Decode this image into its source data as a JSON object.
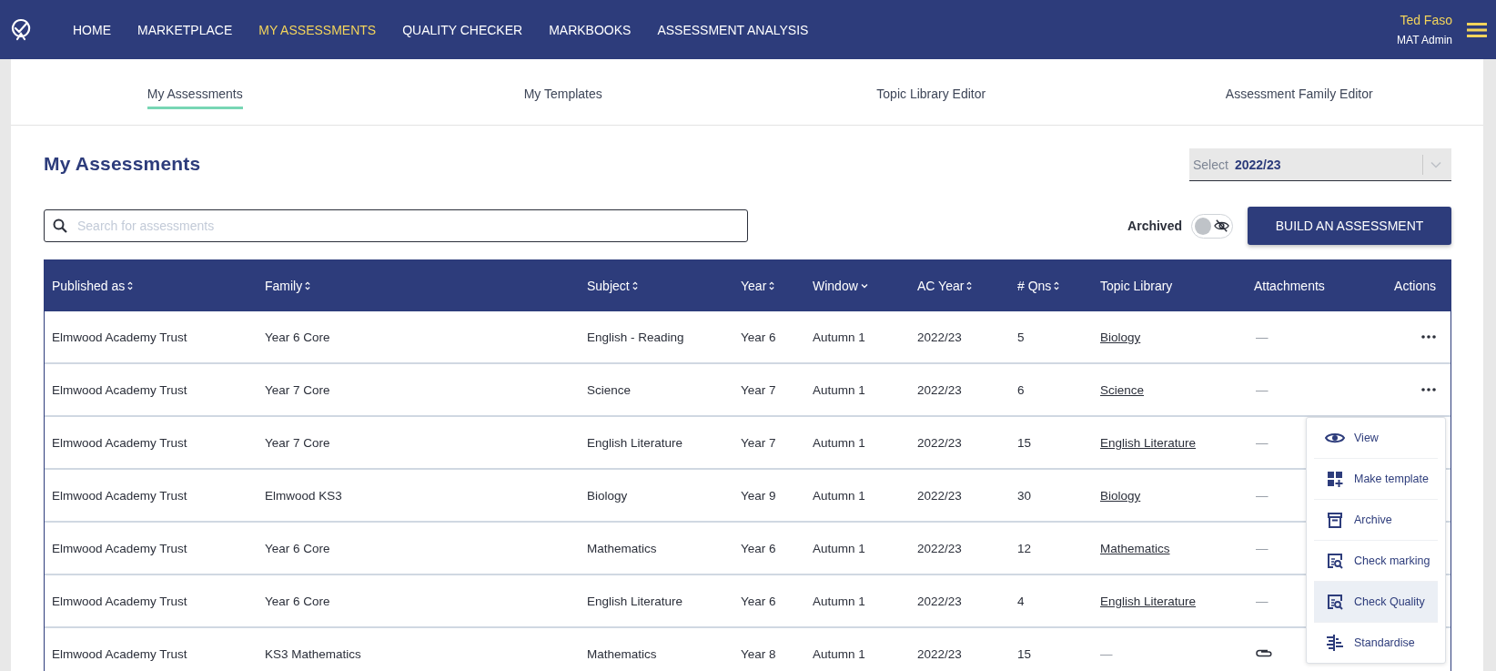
{
  "nav": {
    "items": [
      {
        "label": "HOME",
        "selected": false
      },
      {
        "label": "MARKETPLACE",
        "selected": false
      },
      {
        "label": "MY ASSESSMENTS",
        "selected": true
      },
      {
        "label": "QUALITY CHECKER",
        "selected": false
      },
      {
        "label": "MARKBOOKS",
        "selected": false
      },
      {
        "label": "ASSESSMENT ANALYSIS",
        "selected": false
      }
    ],
    "user": {
      "name": "Ted Faso",
      "role": "MAT Admin"
    }
  },
  "tabs": [
    {
      "label": "My Assessments",
      "selected": true
    },
    {
      "label": "My Templates",
      "selected": false
    },
    {
      "label": "Topic Library Editor",
      "selected": false
    },
    {
      "label": "Assessment Family Editor",
      "selected": false
    }
  ],
  "page_title": "My Assessments",
  "year_select": {
    "label": "Select",
    "value": "2022/23"
  },
  "search": {
    "placeholder": "Search for assessments"
  },
  "archived_toggle": {
    "label": "Archived",
    "on": false
  },
  "build_button": "BUILD AN ASSESSMENT",
  "table": {
    "columns": [
      {
        "label": "Published as",
        "sortable": true,
        "dropdown": false
      },
      {
        "label": "Family",
        "sortable": true,
        "dropdown": false
      },
      {
        "label": "Subject",
        "sortable": true,
        "dropdown": false
      },
      {
        "label": "Year",
        "sortable": true,
        "dropdown": false
      },
      {
        "label": "Window",
        "sortable": false,
        "dropdown": true
      },
      {
        "label": "AC Year",
        "sortable": true,
        "dropdown": false
      },
      {
        "label": "# Qns",
        "sortable": true,
        "dropdown": false
      },
      {
        "label": "Topic Library",
        "sortable": false,
        "dropdown": false
      },
      {
        "label": "Attachments",
        "sortable": false,
        "dropdown": false
      },
      {
        "label": "Actions",
        "sortable": false,
        "dropdown": false
      }
    ],
    "rows": [
      {
        "published_as": "Elmwood Academy Trust",
        "family": "Year 6 Core",
        "subject": "English - Reading",
        "year": "Year 6",
        "window": "Autumn 1",
        "ac_year": "2022/23",
        "qns": "5",
        "topic_library": {
          "kind": "link",
          "text": "Biology"
        },
        "attachments": {
          "kind": "none",
          "text": "—"
        }
      },
      {
        "published_as": "Elmwood Academy Trust",
        "family": "Year 7 Core",
        "subject": "Science",
        "year": "Year 7",
        "window": "Autumn 1",
        "ac_year": "2022/23",
        "qns": "6",
        "topic_library": {
          "kind": "link",
          "text": "Science"
        },
        "attachments": {
          "kind": "none",
          "text": "—"
        }
      },
      {
        "published_as": "Elmwood Academy Trust",
        "family": "Year 7 Core",
        "subject": "English Literature",
        "year": "Year 7",
        "window": "Autumn 1",
        "ac_year": "2022/23",
        "qns": "15",
        "topic_library": {
          "kind": "link",
          "text": "English Literature"
        },
        "attachments": {
          "kind": "none",
          "text": "—"
        }
      },
      {
        "published_as": "Elmwood Academy Trust",
        "family": "Elmwood KS3",
        "subject": "Biology",
        "year": "Year 9",
        "window": "Autumn 1",
        "ac_year": "2022/23",
        "qns": "30",
        "topic_library": {
          "kind": "link",
          "text": "Biology"
        },
        "attachments": {
          "kind": "none",
          "text": "—"
        }
      },
      {
        "published_as": "Elmwood Academy Trust",
        "family": "Year 6 Core",
        "subject": "Mathematics",
        "year": "Year 6",
        "window": "Autumn 1",
        "ac_year": "2022/23",
        "qns": "12",
        "topic_library": {
          "kind": "link",
          "text": "Mathematics"
        },
        "attachments": {
          "kind": "none",
          "text": "—"
        }
      },
      {
        "published_as": "Elmwood Academy Trust",
        "family": "Year 6 Core",
        "subject": "English Literature",
        "year": "Year 6",
        "window": "Autumn 1",
        "ac_year": "2022/23",
        "qns": "4",
        "topic_library": {
          "kind": "link",
          "text": "English Literature"
        },
        "attachments": {
          "kind": "none",
          "text": "—"
        }
      },
      {
        "published_as": "Elmwood Academy Trust",
        "family": "KS3 Mathematics",
        "subject": "Mathematics",
        "year": "Year 8",
        "window": "Autumn 1",
        "ac_year": "2022/23",
        "qns": "15",
        "topic_library": {
          "kind": "none",
          "text": "—"
        },
        "attachments": {
          "kind": "paperclip"
        }
      }
    ]
  },
  "action_menu": {
    "items": [
      {
        "kind": "eye",
        "label": "View",
        "selected": false
      },
      {
        "kind": "grid-plus",
        "label": "Make template",
        "selected": false
      },
      {
        "kind": "archive",
        "label": "Archive",
        "selected": false
      },
      {
        "kind": "check",
        "label": "Check marking",
        "selected": false
      },
      {
        "kind": "check",
        "label": "Check Quality",
        "selected": true
      },
      {
        "kind": "standardise",
        "label": "Standardise",
        "selected": false
      }
    ]
  }
}
